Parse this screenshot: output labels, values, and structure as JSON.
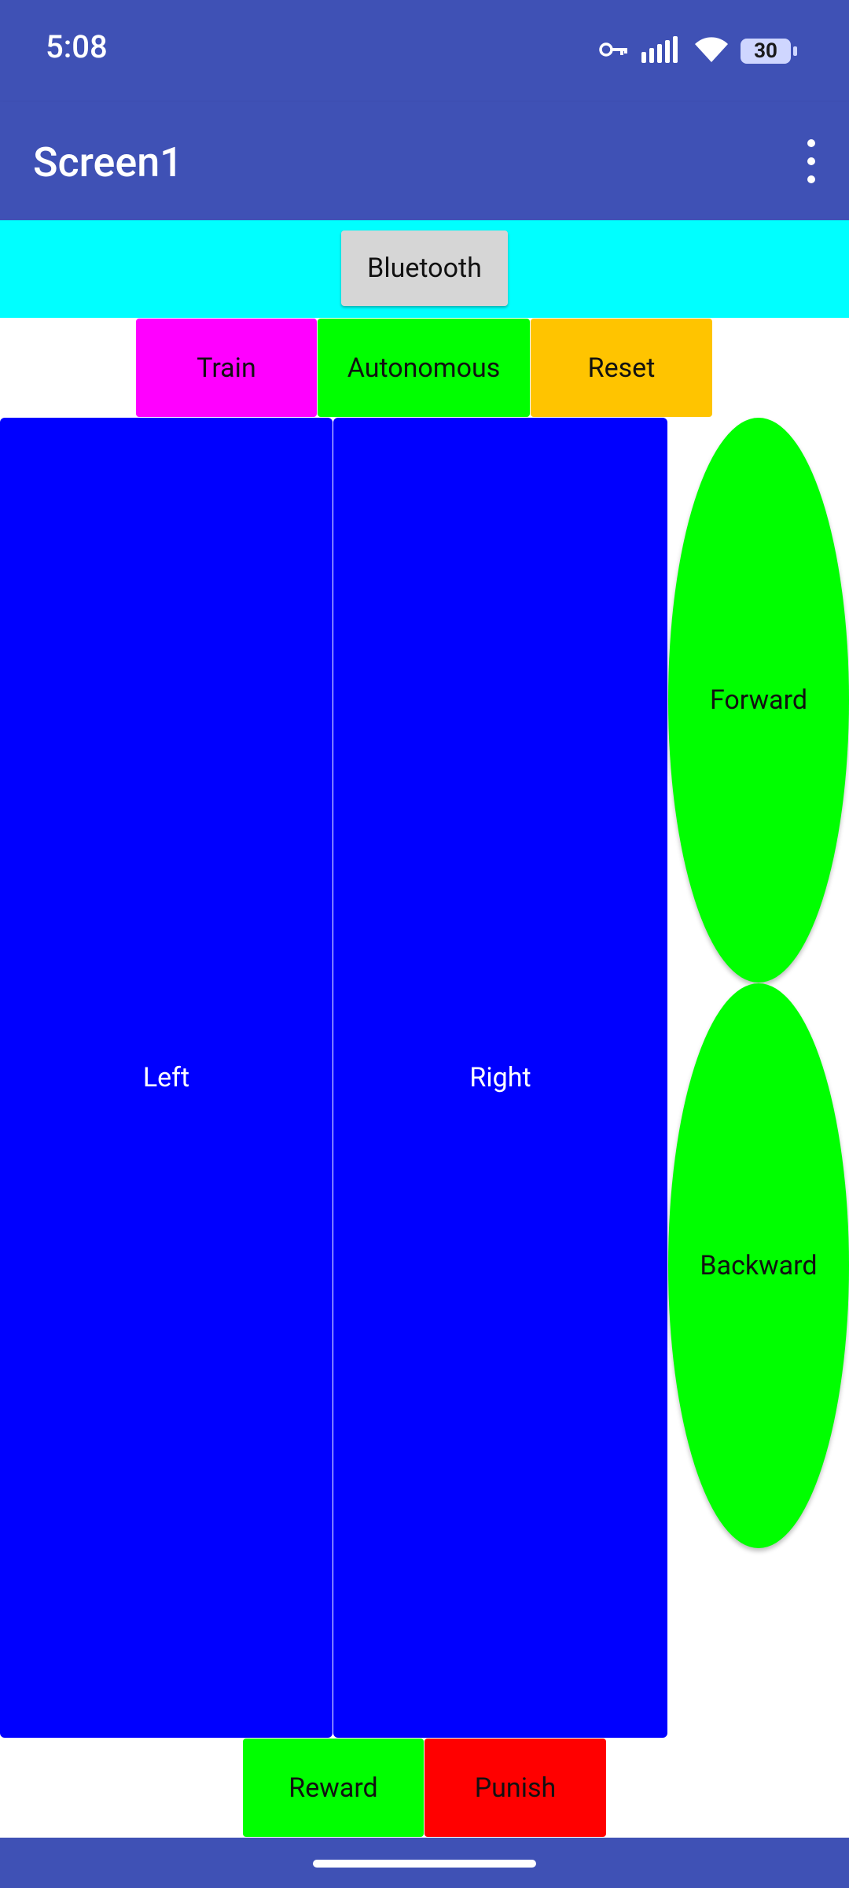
{
  "status_bar": {
    "time": "5:08",
    "battery_level": "30",
    "icons": [
      "vpn-key-icon",
      "signal-icon",
      "wifi-icon",
      "battery-icon"
    ]
  },
  "app_bar": {
    "title": "Screen1",
    "menu_icon": "more-vert-icon"
  },
  "controls": {
    "bluetooth": "Bluetooth",
    "train": "Train",
    "autonomous": "Autonomous",
    "reset": "Reset",
    "left": "Left",
    "right": "Right",
    "forward": "Forward",
    "backward": "Backward",
    "reward": "Reward",
    "punish": "Punish"
  },
  "colors": {
    "app_bar": "#3f51b5",
    "cyan_strip": "#00ffff",
    "train": "#ff00ff",
    "autonomous": "#00ff00",
    "reset": "#ffc400",
    "drive": "#0000ff",
    "forward_backward": "#00ff00",
    "reward": "#00ff00",
    "punish": "#ff0000"
  }
}
